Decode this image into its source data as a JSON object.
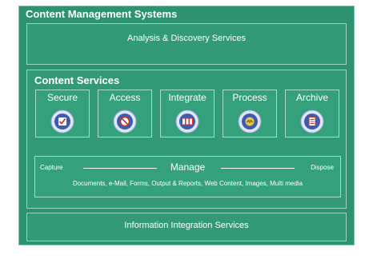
{
  "outer": {
    "title": "Content Management Systems"
  },
  "analysis": {
    "label": "Analysis & Discovery Services"
  },
  "content_services": {
    "title": "Content Services",
    "services": [
      {
        "label": "Secure",
        "icon": "checkmark-shield-icon"
      },
      {
        "label": "Access",
        "icon": "no-entry-icon"
      },
      {
        "label": "Integrate",
        "icon": "integrate-icon"
      },
      {
        "label": "Process",
        "icon": "gear-process-icon"
      },
      {
        "label": "Archive",
        "icon": "document-archive-icon"
      }
    ],
    "manage": {
      "capture": "Capture",
      "title": "Manage",
      "dispose": "Dispose",
      "media_types": "Documents, e-Mail, Forms, Output & Reports, Web Content, Images, Multi media"
    }
  },
  "integration": {
    "label": "Information Integration Services"
  },
  "colors": {
    "background": "#2e9270",
    "panel": "#339a77",
    "box": "#35a07c",
    "icon_blue": "#3f5bb0",
    "text": "#ffffff"
  }
}
